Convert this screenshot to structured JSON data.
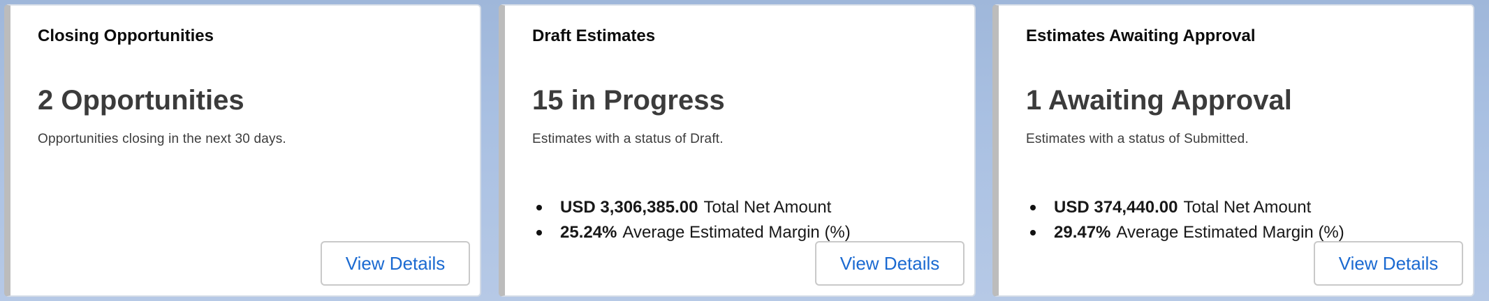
{
  "cards": [
    {
      "title": "Closing Opportunities",
      "headline": "2 Opportunities",
      "description": "Opportunities closing in the next 30 days.",
      "metrics": [],
      "button_label": "View Details"
    },
    {
      "title": "Draft Estimates",
      "headline": "15 in Progress",
      "description": "Estimates with a status of Draft.",
      "metrics": [
        {
          "value": "USD 3,306,385.00",
          "label": "Total Net Amount"
        },
        {
          "value": "25.24%",
          "label": "Average Estimated Margin (%)"
        }
      ],
      "button_label": "View Details"
    },
    {
      "title": "Estimates Awaiting Approval",
      "headline": "1 Awaiting Approval",
      "description": "Estimates with a status of Submitted.",
      "metrics": [
        {
          "value": "USD 374,440.00",
          "label": "Total Net Amount"
        },
        {
          "value": "29.47%",
          "label": "Average Estimated Margin (%)"
        }
      ],
      "button_label": "View Details"
    }
  ],
  "colors": {
    "accent_link": "#1b6ad1",
    "card_left_border": "#bcbcbc",
    "background": "#a9c0e2"
  }
}
